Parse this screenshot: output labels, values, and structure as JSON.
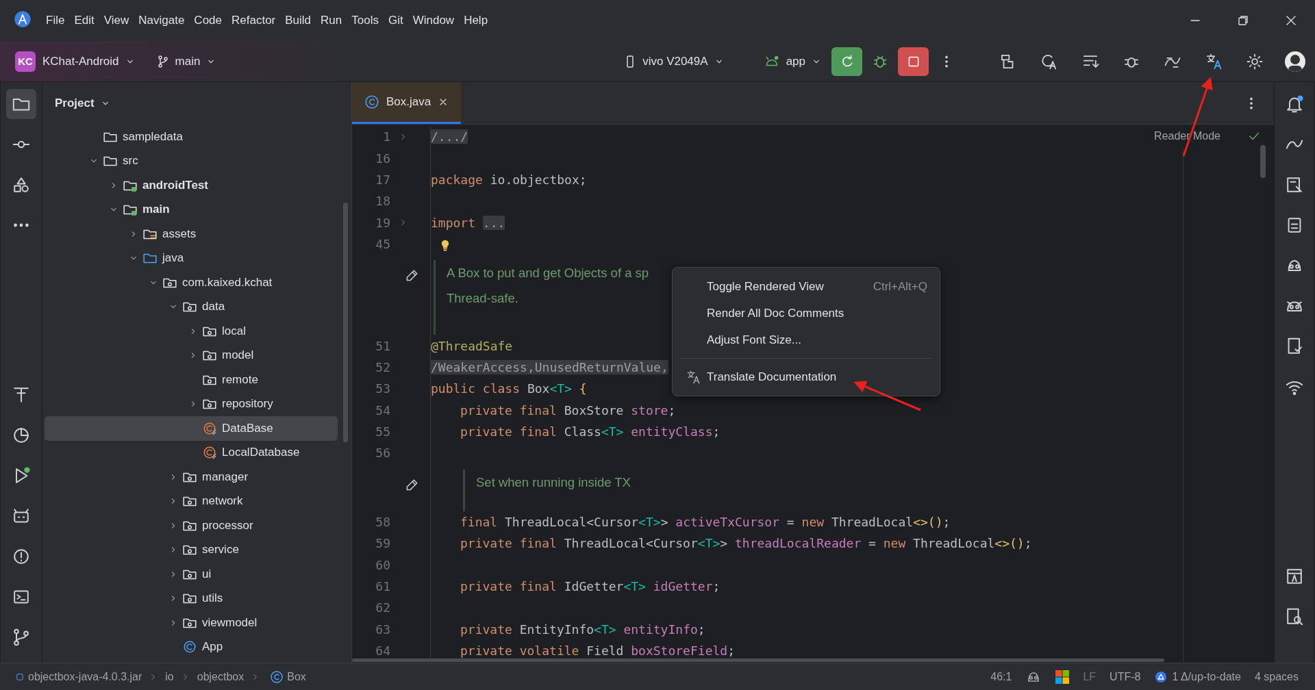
{
  "menu": [
    "File",
    "Edit",
    "View",
    "Navigate",
    "Code",
    "Refactor",
    "Build",
    "Run",
    "Tools",
    "Git",
    "Window",
    "Help"
  ],
  "toolbar": {
    "project_badge": "KC",
    "project": "KChat-Android",
    "branch": "main",
    "device": "vivo V2049A",
    "run_config": "app"
  },
  "project_panel": {
    "title": "Project",
    "tree": [
      {
        "label": "sampledata",
        "kind": "folder",
        "selected": false
      },
      {
        "label": "src",
        "kind": "folder",
        "selected": false,
        "expanded": true,
        "children": [
          {
            "label": "androidTest",
            "kind": "module",
            "selected": false,
            "expanded": false
          },
          {
            "label": "main",
            "kind": "module",
            "selected": false,
            "expanded": true,
            "children": [
              {
                "label": "assets",
                "kind": "resources",
                "selected": false,
                "expanded": false
              },
              {
                "label": "java",
                "kind": "source",
                "selected": false,
                "expanded": true,
                "children": [
                  {
                    "label": "com.kaixed.kchat",
                    "kind": "package",
                    "selected": false,
                    "expanded": true,
                    "children": [
                      {
                        "label": "data",
                        "kind": "package",
                        "selected": false,
                        "expanded": true,
                        "children": [
                          {
                            "label": "local",
                            "kind": "package",
                            "selected": false,
                            "expanded": false
                          },
                          {
                            "label": "model",
                            "kind": "package",
                            "selected": false,
                            "expanded": false
                          },
                          {
                            "label": "remote",
                            "kind": "package",
                            "selected": false
                          },
                          {
                            "label": "repository",
                            "kind": "package",
                            "selected": false,
                            "expanded": false
                          },
                          {
                            "label": "DataBase",
                            "kind": "db",
                            "selected": true
                          },
                          {
                            "label": "LocalDatabase",
                            "kind": "db",
                            "selected": false
                          }
                        ]
                      },
                      {
                        "label": "manager",
                        "kind": "package",
                        "selected": false,
                        "expanded": false
                      },
                      {
                        "label": "network",
                        "kind": "package",
                        "selected": false,
                        "expanded": false
                      },
                      {
                        "label": "processor",
                        "kind": "package",
                        "selected": false,
                        "expanded": false
                      },
                      {
                        "label": "service",
                        "kind": "package",
                        "selected": false,
                        "expanded": false
                      },
                      {
                        "label": "ui",
                        "kind": "package",
                        "selected": false,
                        "expanded": false
                      },
                      {
                        "label": "utils",
                        "kind": "package",
                        "selected": false,
                        "expanded": false
                      },
                      {
                        "label": "viewmodel",
                        "kind": "package",
                        "selected": false,
                        "expanded": false
                      },
                      {
                        "label": "App",
                        "kind": "app",
                        "selected": false
                      }
                    ]
                  }
                ]
              }
            ]
          }
        ]
      }
    ]
  },
  "tabs": [
    {
      "label": "Box.java",
      "selected": true
    }
  ],
  "editor": {
    "reader_mode": "Reader Mode",
    "lines": [
      {
        "kind": "code",
        "number": "1",
        "foldable": true,
        "tokens": [
          {
            "text": "/.../",
            "kind": "folded"
          }
        ]
      },
      {
        "kind": "code",
        "number": "16"
      },
      {
        "kind": "code",
        "number": "17",
        "tokens": [
          {
            "text": "package ",
            "kind": "keyword"
          },
          {
            "text": "io.objectbox;",
            "kind": "plain"
          }
        ]
      },
      {
        "kind": "code",
        "number": "18"
      },
      {
        "kind": "code",
        "number": "19",
        "foldable": true,
        "tokens": [
          {
            "text": "import ",
            "kind": "keyword"
          },
          {
            "text": "...",
            "kind": "folded"
          }
        ]
      },
      {
        "kind": "code",
        "number": "45",
        "bulb": true
      },
      {
        "kind": "doc",
        "text": [
          "A Box to put and get Objects of a sp",
          "Thread-safe."
        ]
      },
      {
        "kind": "code",
        "number": "51",
        "tokens": [
          {
            "text": "@ThreadSafe",
            "kind": "annotation"
          }
        ]
      },
      {
        "kind": "code",
        "number": "52",
        "tokens": [
          {
            "text": "/WeakerAccess,UnusedReturnValue,",
            "kind": "folded"
          }
        ]
      },
      {
        "kind": "code",
        "number": "53",
        "tokens": [
          {
            "text": "public class ",
            "kind": "keyword"
          },
          {
            "text": "Box",
            "kind": "plain"
          },
          {
            "text": "<T> ",
            "kind": "param"
          },
          {
            "text": "{",
            "kind": "brace"
          }
        ]
      },
      {
        "kind": "code",
        "number": "54",
        "indented": true,
        "tokens": [
          {
            "text": "private final ",
            "kind": "keyword"
          },
          {
            "text": "BoxStore ",
            "kind": "plain"
          },
          {
            "text": "store",
            "kind": "field"
          },
          {
            "text": ";",
            "kind": "plain"
          }
        ]
      },
      {
        "kind": "code",
        "number": "55",
        "indented": true,
        "tokens": [
          {
            "text": "private final ",
            "kind": "keyword"
          },
          {
            "text": "Class",
            "kind": "plain"
          },
          {
            "text": "<T> ",
            "kind": "param"
          },
          {
            "text": "entityClass",
            "kind": "field"
          },
          {
            "text": ";",
            "kind": "plain"
          }
        ]
      },
      {
        "kind": "code",
        "number": "56"
      },
      {
        "kind": "doc",
        "indented": true,
        "text": [
          "Set when running inside TX"
        ]
      },
      {
        "kind": "code",
        "number": "58",
        "indented": true,
        "tokens": [
          {
            "text": "final ",
            "kind": "keyword"
          },
          {
            "text": "ThreadLocal<Cursor",
            "kind": "plain"
          },
          {
            "text": "<T>",
            "kind": "param"
          },
          {
            "text": "> ",
            "kind": "plain"
          },
          {
            "text": "activeTxCursor",
            "kind": "field"
          },
          {
            "text": " = ",
            "kind": "plain"
          },
          {
            "text": "new ",
            "kind": "keyword"
          },
          {
            "text": "ThreadLocal",
            "kind": "plain"
          },
          {
            "text": "<>()",
            "kind": "brace"
          },
          {
            "text": ";",
            "kind": "plain"
          }
        ]
      },
      {
        "kind": "code",
        "number": "59",
        "indented": true,
        "tokens": [
          {
            "text": "private final ",
            "kind": "keyword"
          },
          {
            "text": "ThreadLocal<Cursor",
            "kind": "plain"
          },
          {
            "text": "<T>",
            "kind": "param"
          },
          {
            "text": "> ",
            "kind": "plain"
          },
          {
            "text": "threadLocalReader",
            "kind": "field"
          },
          {
            "text": " = ",
            "kind": "plain"
          },
          {
            "text": "new ",
            "kind": "keyword"
          },
          {
            "text": "ThreadLocal",
            "kind": "plain"
          },
          {
            "text": "<>()",
            "kind": "brace"
          },
          {
            "text": ";",
            "kind": "plain"
          }
        ]
      },
      {
        "kind": "code",
        "number": "60"
      },
      {
        "kind": "code",
        "number": "61",
        "indented": true,
        "tokens": [
          {
            "text": "private final ",
            "kind": "keyword"
          },
          {
            "text": "IdGetter",
            "kind": "plain"
          },
          {
            "text": "<T> ",
            "kind": "param"
          },
          {
            "text": "idGetter",
            "kind": "field"
          },
          {
            "text": ";",
            "kind": "plain"
          }
        ]
      },
      {
        "kind": "code",
        "number": "62"
      },
      {
        "kind": "code",
        "number": "63",
        "indented": true,
        "tokens": [
          {
            "text": "private ",
            "kind": "keyword"
          },
          {
            "text": "EntityInfo",
            "kind": "plain"
          },
          {
            "text": "<T> ",
            "kind": "param"
          },
          {
            "text": "entityInfo",
            "kind": "field"
          },
          {
            "text": ";",
            "kind": "plain"
          }
        ]
      },
      {
        "kind": "code",
        "number": "64",
        "indented": true,
        "tokens": [
          {
            "text": "private volatile ",
            "kind": "keyword"
          },
          {
            "text": "Field ",
            "kind": "plain"
          },
          {
            "text": "boxStoreField",
            "kind": "field"
          },
          {
            "text": ";",
            "kind": "plain"
          }
        ]
      }
    ]
  },
  "popup": {
    "items": [
      {
        "kind": "action",
        "label": "Toggle Rendered View",
        "shortcut": "Ctrl+Alt+Q"
      },
      {
        "kind": "action",
        "label": "Render All Doc Comments"
      },
      {
        "kind": "action",
        "label": "Adjust Font Size..."
      },
      {
        "kind": "separator"
      },
      {
        "kind": "translate",
        "label": "Translate Documentation"
      }
    ]
  },
  "status_bar": {
    "breadcrumbs": [
      {
        "label": "objectbox-java-4.0.3.jar",
        "kind": "jar"
      },
      {
        "label": "io",
        "kind": "package"
      },
      {
        "label": "objectbox",
        "kind": "package"
      },
      {
        "label": "Box",
        "kind": "class"
      }
    ],
    "position": "46:1",
    "line_separator": "LF",
    "encoding": "UTF-8",
    "vcs": "1 Δ/up-to-date",
    "indent": "4 spaces"
  }
}
